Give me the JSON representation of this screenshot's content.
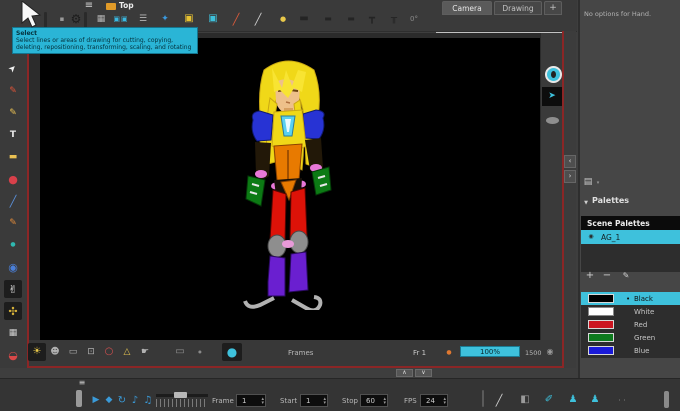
{
  "top_toolbar": {
    "menu_icon": "≡",
    "document_label": "Top",
    "icons": [
      {
        "name": "plug-icon",
        "glyph": "▪",
        "color": "#9a9a9a"
      },
      {
        "name": "gear-icon",
        "glyph": "⚙",
        "color": "#1c1c1c"
      },
      {
        "name": "grid-icon",
        "glyph": "▦",
        "color": "#b4b4b4"
      },
      {
        "name": "onion-skin-icon",
        "glyph": "▣▣",
        "color": "#3ab8e0"
      },
      {
        "name": "exposure-sheet-icon",
        "glyph": "☰",
        "color": "#b4b4b4"
      },
      {
        "name": "antenna-icon",
        "glyph": "✦",
        "color": "#3a9ae0"
      },
      {
        "name": "lock-icon",
        "glyph": "▣",
        "color": "#e8c232"
      },
      {
        "name": "unlock-icon",
        "glyph": "▣",
        "color": "#3ec1dc"
      },
      {
        "name": "pen-stroke-icon",
        "glyph": "╱",
        "color": "#d85a3a"
      },
      {
        "name": "line-stroke-icon",
        "glyph": "╱",
        "color": "#cccccc"
      },
      {
        "name": "light-icon",
        "glyph": "●",
        "color": "#e8c84a"
      },
      {
        "name": "flat-tool-icon-1",
        "glyph": "▬",
        "color": "#242424"
      },
      {
        "name": "flat-tool-icon-2",
        "glyph": "▬",
        "color": "#242424"
      },
      {
        "name": "flat-tool-icon-3",
        "glyph": "▬",
        "color": "#242424"
      },
      {
        "name": "stamp-icon",
        "glyph": "┳",
        "color": "#242424"
      },
      {
        "name": "bench-icon",
        "glyph": "╥",
        "color": "#242424"
      },
      {
        "name": "rotation-reset-icon",
        "glyph": "0°",
        "color": "#8a8a8a"
      }
    ],
    "tabs": [
      {
        "label": "Camera",
        "active": true
      },
      {
        "label": "Drawing",
        "active": false
      }
    ],
    "add_view_label": "+"
  },
  "tooltip": {
    "title": "Select",
    "line1": "Select lines or areas of drawing for cutting, copying,",
    "line2": "deleting, repositioning, transforming, scaling, and rotating"
  },
  "tool_properties": {
    "message": "No options for Hand."
  },
  "left_toolbar": {
    "tools": [
      {
        "name": "select-tool",
        "glyph": "➤",
        "color": "#f0f0f0",
        "selected": false
      },
      {
        "name": "pencil-tool",
        "glyph": "✎",
        "color": "#e05438",
        "selected": false
      },
      {
        "name": "brush-tool",
        "glyph": "✎",
        "color": "#eac153",
        "selected": false
      },
      {
        "name": "text-tool",
        "glyph": "T",
        "color": "#e8e8e8",
        "selected": false
      },
      {
        "name": "eraser-tool",
        "glyph": "▬",
        "color": "#eac153",
        "selected": false
      },
      {
        "name": "paint-bucket-tool",
        "glyph": "●",
        "color": "#d8404a",
        "selected": false
      },
      {
        "name": "line-tool",
        "glyph": "╱",
        "color": "#5a8fd8",
        "selected": false
      },
      {
        "name": "contour-pencil-tool",
        "glyph": "✎",
        "color": "#e08a3a",
        "selected": false
      },
      {
        "name": "dropper-tool",
        "glyph": "●",
        "color": "#2fb8b0",
        "selected": false
      },
      {
        "name": "zoom-tool",
        "glyph": "◉",
        "color": "#4a7fd8",
        "selected": false
      },
      {
        "name": "hand-tool",
        "glyph": "✌",
        "color": "#f0f0f0",
        "selected": true
      },
      {
        "name": "rotate-view-tool",
        "glyph": "✣",
        "color": "#d8b33a",
        "selected": true
      },
      {
        "name": "grid-tool",
        "glyph": "▦",
        "color": "#d0d0d0",
        "selected": false
      },
      {
        "name": "palette-pot-tool",
        "glyph": "◒",
        "color": "#d84848",
        "selected": false
      }
    ]
  },
  "view": {
    "statusbar": {
      "icons": [
        {
          "name": "light-bulb-icon",
          "glyph": "☀",
          "color": "#e8c84a"
        },
        {
          "name": "character-view-icon",
          "glyph": "☻",
          "color": "#b0b0b0"
        },
        {
          "name": "frame-border-icon",
          "glyph": "▭",
          "color": "#b0b0b0"
        },
        {
          "name": "safe-area-icon",
          "glyph": "⊡",
          "color": "#b0b0b0"
        },
        {
          "name": "red-ring-icon",
          "glyph": "○",
          "color": "#d85050"
        },
        {
          "name": "warning-triangle-icon",
          "glyph": "△",
          "color": "#e0c050"
        },
        {
          "name": "hand-pointer-icon",
          "glyph": "☛",
          "color": "#b0b0b0"
        },
        {
          "name": "battery-icon",
          "glyph": "▭",
          "color": "#909090"
        },
        {
          "name": "small-dot-icon",
          "glyph": "●",
          "color": "#8a8a8a"
        },
        {
          "name": "play-circle-icon",
          "glyph": "●",
          "color": "#3ec1dc"
        }
      ],
      "frames_label": "Frames",
      "frame_indicator": "Fr 1",
      "zoom_value": "100%",
      "resolution_value": "1500",
      "status_icon": "◉"
    },
    "side_buttons": {
      "camera_icon": "➤",
      "collapse_left": "‹",
      "collapse_right": "›"
    }
  },
  "palette_panel": {
    "panel_icon": "▤",
    "panel_icon_caret": "▾",
    "header_caret": "▼",
    "panel_header": "Palettes",
    "list_header": "Scene Palettes",
    "palette_icon": "◉",
    "palette_name": "AG_1",
    "add_label": "+",
    "remove_label": "−",
    "edit_icon": "✎",
    "selected_marker": "•",
    "accent": "#3ec1dc",
    "colors": [
      {
        "name": "Black",
        "hex": "#000000",
        "selected": true
      },
      {
        "name": "White",
        "hex": "#ffffff",
        "selected": false
      },
      {
        "name": "Red",
        "hex": "#cc1520",
        "selected": false
      },
      {
        "name": "Green",
        "hex": "#0e7a1e",
        "selected": false
      },
      {
        "name": "Blue",
        "hex": "#1a1ad8",
        "selected": false
      }
    ]
  },
  "timeline": {
    "menu_icon": "≡",
    "playback": [
      {
        "name": "play-button",
        "glyph": "▶",
        "color": "#3a9ad8"
      },
      {
        "name": "render-play-button",
        "glyph": "◆",
        "color": "#3a9ad8"
      },
      {
        "name": "loop-button",
        "glyph": "↻",
        "color": "#3a9ad8"
      },
      {
        "name": "sound-button",
        "glyph": "♪",
        "color": "#3a9ad8"
      },
      {
        "name": "sound-scrub-button",
        "glyph": "♫",
        "color": "#3a9ad8"
      }
    ],
    "frame_label": "Frame",
    "frame_value": "1",
    "start_label": "Start",
    "start_value": "1",
    "stop_label": "Stop",
    "stop_value": "60",
    "fps_label": "FPS",
    "fps_value": "24",
    "spinner_up": "▴",
    "spinner_down": "▾",
    "right_icons": [
      {
        "name": "line-style-icon",
        "glyph": "╱",
        "color": "#cccccc"
      },
      {
        "name": "camera-mask-icon",
        "glyph": "◧",
        "color": "#9a9a9a"
      },
      {
        "name": "paint-mode-icon",
        "glyph": "✐",
        "color": "#3ec1dc"
      },
      {
        "name": "puppet-icon-1",
        "glyph": "♟",
        "color": "#3ec1dc"
      },
      {
        "name": "puppet-icon-2",
        "glyph": "♟",
        "color": "#3ec1dc"
      },
      {
        "name": "dots-icon",
        "glyph": "· ·",
        "color": "#8a8a8a"
      }
    ],
    "collapse_up": "∧",
    "collapse_down": "∨"
  }
}
